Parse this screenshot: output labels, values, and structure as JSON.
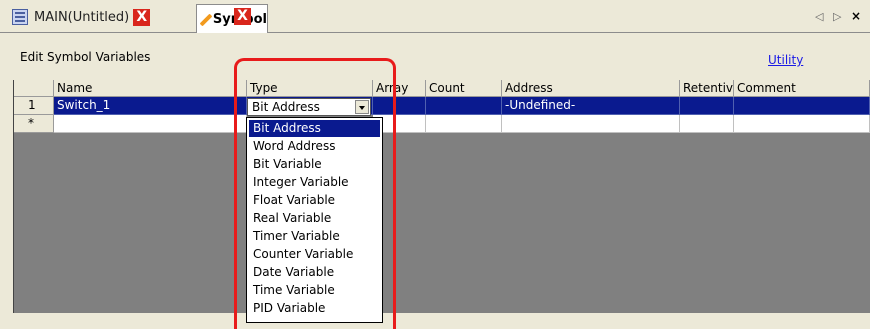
{
  "tabs": [
    {
      "label": "MAIN(Untitled)"
    },
    {
      "label": "Symbol"
    }
  ],
  "close_glyph": "X",
  "nav": {
    "left": "◁",
    "right": "▷",
    "close": "×"
  },
  "panel": {
    "title": "Edit Symbol Variables",
    "utility_link": "Utility"
  },
  "grid": {
    "columns": [
      "Name",
      "Type",
      "Array",
      "Count",
      "Address",
      "Retentiv",
      "Comment"
    ],
    "rows": [
      {
        "marker": "1",
        "name": "Switch_1",
        "type": "Bit Address",
        "array": "",
        "count": "",
        "address": "-Undefined-",
        "retentive": "",
        "comment": ""
      },
      {
        "marker": "*",
        "name": "",
        "type": "",
        "array": "",
        "count": "",
        "address": "",
        "retentive": "",
        "comment": ""
      }
    ]
  },
  "type_dropdown": {
    "selected": "Bit Address",
    "options": [
      "Bit Address",
      "Word Address",
      "Bit Variable",
      "Integer Variable",
      "Float Variable",
      "Real Variable",
      "Timer Variable",
      "Counter Variable",
      "Date Variable",
      "Time Variable",
      "PID Variable"
    ]
  },
  "colors": {
    "selection": "#0a1a8f",
    "highlight_border": "#e81b1b",
    "close_button": "#d9261c",
    "link": "#1a1ae6"
  },
  "icons": [
    "main-screen-icon",
    "pencil-icon",
    "close-icon",
    "scroll-left-icon",
    "scroll-right-icon"
  ]
}
